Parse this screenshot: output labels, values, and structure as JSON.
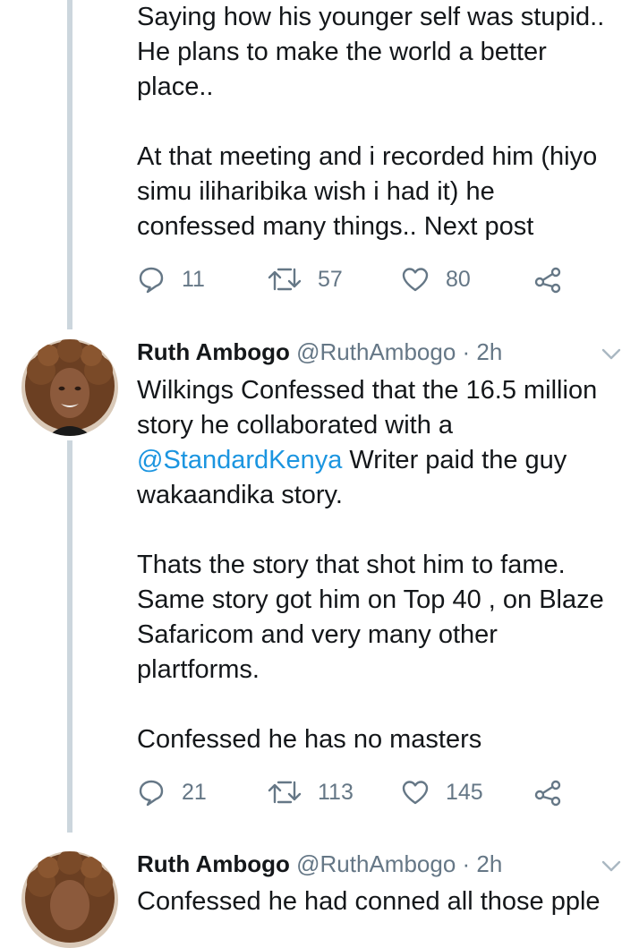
{
  "tweets": [
    {
      "paragraphs": [
        [
          "Saying how his younger self was stupid..",
          "He plans to make the world a better",
          "place.."
        ],
        [
          "At that meeting and i recorded him (hiyo",
          "simu iliharibika wish i had it) he",
          "confessed many things.. Next post"
        ]
      ],
      "actions": {
        "replies": "11",
        "retweets": "57",
        "likes": "80"
      }
    },
    {
      "name": "Ruth Ambogo",
      "handle": "@RuthAmbogo",
      "separator": "·",
      "time": "2h",
      "line1": "Wilkings Confessed that the 16.5 million",
      "line2": "story he collaborated with a",
      "mention": "@StandardKenya",
      "line3_rest": " Writer paid the guy",
      "line4": "wakaandika story.",
      "paragraph2": [
        "Thats the story that shot him to fame.",
        "Same story got him on Top 40 , on Blaze",
        "Safaricom and very many other",
        "plartforms."
      ],
      "paragraph3": "Confessed he has no masters",
      "actions": {
        "replies": "21",
        "retweets": "113",
        "likes": "145"
      }
    },
    {
      "name": "Ruth Ambogo",
      "handle": "@RuthAmbogo",
      "separator": "·",
      "time": "2h",
      "line1": "Confessed he had conned all those pple"
    }
  ],
  "icons": {
    "reply": "reply-icon",
    "retweet": "retweet-icon",
    "like": "heart-icon",
    "share": "share-icon",
    "menu": "chevron-down-icon"
  },
  "colors": {
    "text": "#14171a",
    "secondary": "#657786",
    "link": "#1b95e0",
    "thread_line": "#ccd6dd"
  }
}
